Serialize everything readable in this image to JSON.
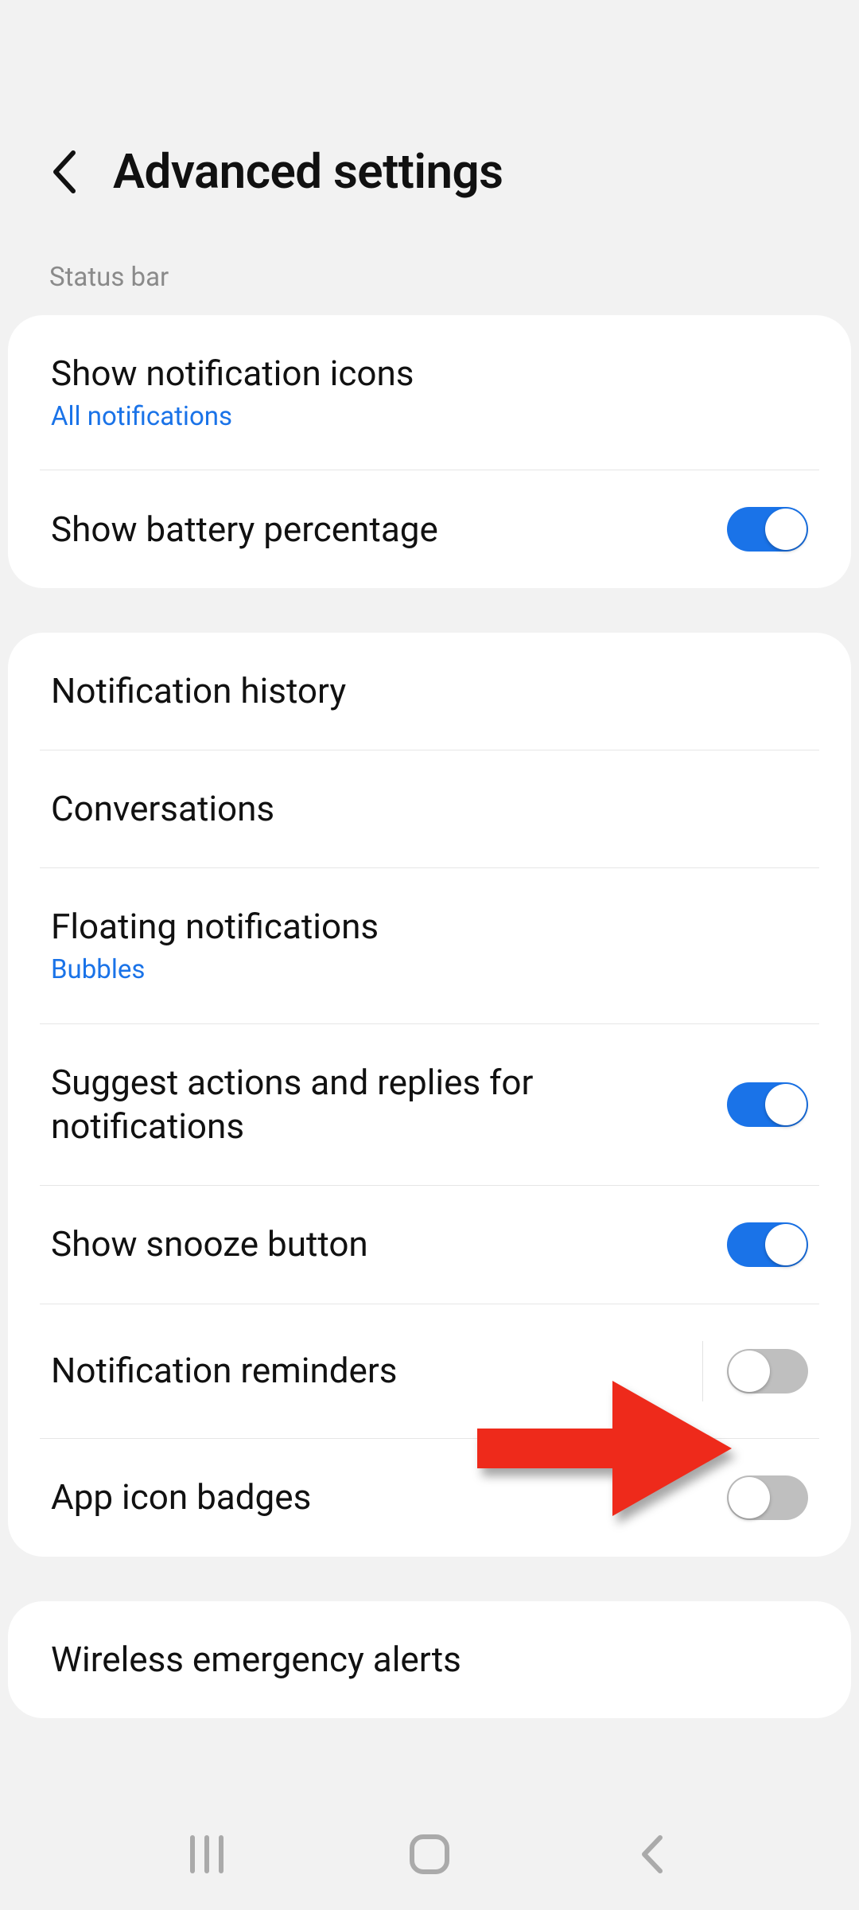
{
  "header": {
    "title": "Advanced settings"
  },
  "sections": {
    "status_bar_label": "Status bar"
  },
  "rows": {
    "show_notification_icons": {
      "title": "Show notification icons",
      "sub": "All notifications"
    },
    "show_battery_percentage": {
      "title": "Show battery percentage",
      "on": true
    },
    "notification_history": {
      "title": "Notification history"
    },
    "conversations": {
      "title": "Conversations"
    },
    "floating_notifications": {
      "title": "Floating notifications",
      "sub": "Bubbles"
    },
    "suggest_actions": {
      "title": "Suggest actions and replies for notifications",
      "on": true
    },
    "show_snooze": {
      "title": "Show snooze button",
      "on": true
    },
    "notification_reminders": {
      "title": "Notification reminders",
      "on": false
    },
    "app_icon_badges": {
      "title": "App icon badges",
      "on": false
    },
    "wireless_emergency_alerts": {
      "title": "Wireless emergency alerts"
    }
  },
  "colors": {
    "accent": "#1a73e8",
    "annotation": "#ee2a1b"
  },
  "annotation": {
    "target": "app-icon-badges-toggle"
  }
}
